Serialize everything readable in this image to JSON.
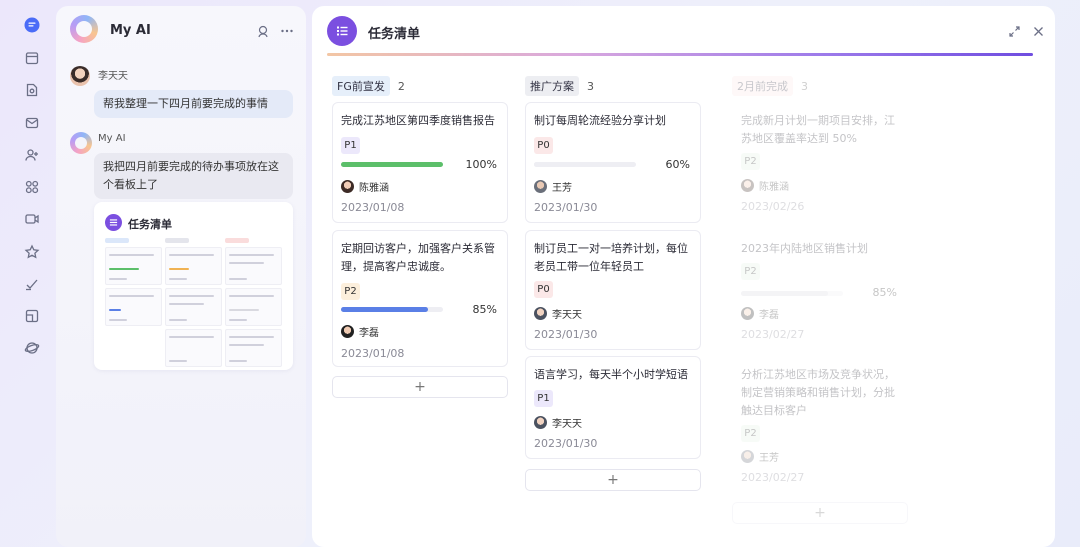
{
  "rail": {
    "icons": [
      "chat-icon",
      "calendar-icon",
      "document-icon",
      "mail-icon",
      "contacts-icon",
      "apps-icon",
      "video-icon",
      "star-icon",
      "approval-icon",
      "template-icon",
      "discover-icon"
    ],
    "accent": "#4a6cf7"
  },
  "chat": {
    "title": "My AI",
    "user_name": "李天天",
    "user_message": "帮我整理一下四月前要完成的事情",
    "ai_name": "My AI",
    "ai_message": "我把四月前要完成的待办事项放在这个看板上了",
    "preview_title": "任务清单"
  },
  "board": {
    "title": "任务清单",
    "add_label": "+",
    "columns": [
      {
        "name": "FG前宣发",
        "count": "2",
        "tag_color": "#e6effa",
        "tasks": [
          {
            "title": "完成江苏地区第四季度销售报告",
            "priority": "P1",
            "progress": 100,
            "progress_label": "100%",
            "assignee": "陈雅涵",
            "date": "2023/01/08"
          },
          {
            "title": "定期回访客户，加强客户关系管理，提高客户忠诚度。",
            "priority": "P2",
            "progress": 85,
            "progress_label": "85%",
            "assignee": "李磊",
            "date": "2023/01/08"
          }
        ]
      },
      {
        "name": "推广方案",
        "count": "3",
        "tag_color": "#edeef2",
        "tasks": [
          {
            "title": "制订每周轮流经验分享计划",
            "priority": "P0",
            "progress": 60,
            "progress_label": "60%",
            "assignee": "王芳",
            "date": "2023/01/30"
          },
          {
            "title": "制订员工一对一培养计划，每位老员工带一位年轻员工",
            "priority": "P0",
            "assignee": "李天天",
            "date": "2023/01/30"
          },
          {
            "title": "语言学习，每天半个小时学短语",
            "priority": "P1",
            "assignee": "李天天",
            "date": "2023/01/30"
          }
        ]
      },
      {
        "name": "2月前完成",
        "count": "3",
        "tag_color": "#fbe6e6",
        "tasks": [
          {
            "title": "完成新月计划一期项目安排，江苏地区覆盖率达到 50%",
            "priority": "P2",
            "assignee": "陈雅涵",
            "date": "2023/02/26"
          },
          {
            "title": "2023年内陆地区销售计划",
            "priority": "P2",
            "progress": 85,
            "progress_label": "85%",
            "assignee": "李磊",
            "date": "2023/02/27"
          },
          {
            "title": "分析江苏地区市场及竞争状况，制定营销策略和销售计划，分批触达目标客户",
            "priority": "P2",
            "assignee": "王芳",
            "date": "2023/02/27"
          }
        ]
      }
    ]
  },
  "colors": {
    "brand_purple": "#7b4fe0",
    "p0": "#fbe8e8",
    "p1": "#ece8fb",
    "p2": "#fcefdc",
    "p2_faded": "#e3f4e6",
    "progress_green": "#5cbf6a",
    "progress_blue": "#5a7fe6",
    "progress_grey": "#d9d9e0"
  }
}
